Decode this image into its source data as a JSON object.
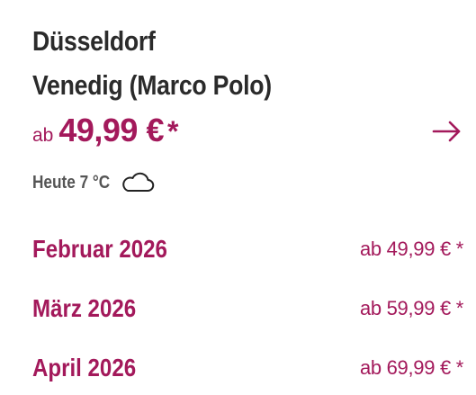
{
  "route": {
    "from": "Düsseldorf",
    "to": "Venedig (Marco Polo)"
  },
  "price": {
    "prefix": "ab",
    "value": "49,99 €",
    "star": "*"
  },
  "weather": {
    "text": "Heute 7 °C",
    "icon": "cloud-icon"
  },
  "months": [
    {
      "label": "Februar 2026",
      "price": "ab 49,99 € *"
    },
    {
      "label": "März 2026",
      "price": "ab 59,99 € *"
    },
    {
      "label": "April 2026",
      "price": "ab 69,99 € *"
    }
  ],
  "colors": {
    "accent": "#a3195b",
    "title": "#2b2b2b",
    "muted": "#555555"
  }
}
